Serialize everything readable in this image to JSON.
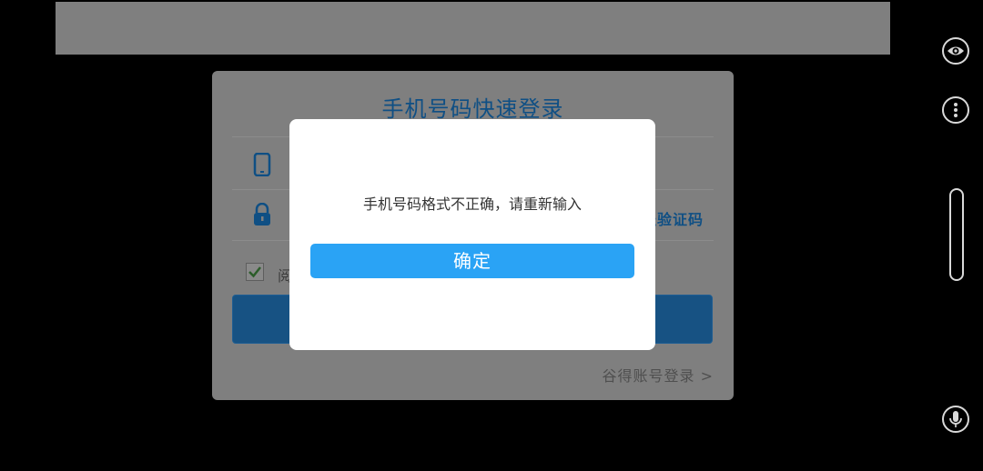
{
  "login": {
    "title": "手机号码快速登录",
    "code_link": "发送验证码",
    "agree_text": "阅读并同意",
    "alt_login": "谷得账号登录 >"
  },
  "modal": {
    "message": "手机号码格式不正确，请重新输入",
    "confirm_label": "确定"
  },
  "colors": {
    "overlay_bg": "#7f7f7f",
    "brand_blue": "#0f4f84",
    "confirm_blue": "#2aa3f5",
    "modal_bg": "#ffffff"
  },
  "icons": {
    "phone": "phone-icon",
    "lock": "lock-icon",
    "check": "checkmark-icon",
    "eye": "eye-icon",
    "menu": "more-vertical-icon",
    "mic": "microphone-icon"
  }
}
